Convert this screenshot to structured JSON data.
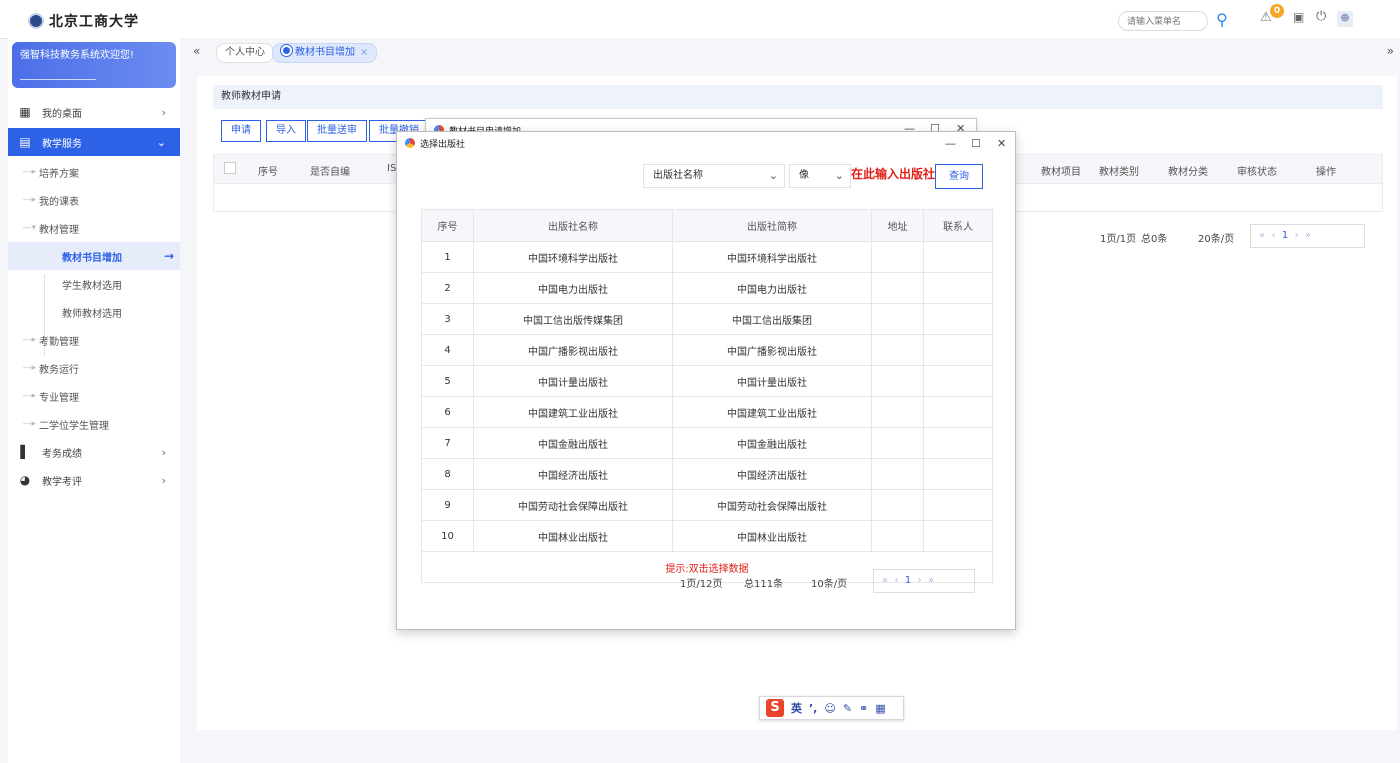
{
  "header": {
    "school_name": "北京工商大学",
    "search_placeholder": "请输入菜单名",
    "notification_count": "0"
  },
  "sidebar": {
    "welcome": "强智科技教务系统欢迎您!",
    "items": [
      {
        "label": "我的桌面"
      },
      {
        "label": "教学服务"
      },
      {
        "label": "培养方案"
      },
      {
        "label": "我的课表"
      },
      {
        "label": "教材管理"
      },
      {
        "label": "教材书目增加"
      },
      {
        "label": "学生教材选用"
      },
      {
        "label": "教师教材选用"
      },
      {
        "label": "考勤管理"
      },
      {
        "label": "教务运行"
      },
      {
        "label": "专业管理"
      },
      {
        "label": "二学位学生管理"
      },
      {
        "label": "考务成绩"
      },
      {
        "label": "教学考评"
      }
    ]
  },
  "tabs": {
    "home": "个人中心",
    "current": "教材书目增加"
  },
  "main": {
    "section_title": "教师教材申请",
    "buttons": [
      "申请",
      "导入",
      "批量送审",
      "批量撤销"
    ],
    "columns": [
      "序号",
      "是否自编",
      "IS",
      "教材项目",
      "教材类别",
      "教材分类",
      "审核状态",
      "操作"
    ],
    "pager": {
      "pages": "1页/1页",
      "total": "总0条",
      "size": "20条/页",
      "current": "1"
    }
  },
  "dialog_back": {
    "title": "教材书目申请增加"
  },
  "dialog": {
    "title": "选择出版社",
    "filter_field": "出版社名称",
    "filter_op": "像",
    "hint": "在此输入出版社",
    "query_label": "查询",
    "columns": [
      "序号",
      "出版社名称",
      "出版社简称",
      "地址",
      "联系人"
    ],
    "rows": [
      {
        "no": "1",
        "name": "中国环境科学出版社",
        "short": "中国环境科学出版社"
      },
      {
        "no": "2",
        "name": "中国电力出版社",
        "short": "中国电力出版社"
      },
      {
        "no": "3",
        "name": "中国工信出版传媒集团",
        "short": "中国工信出版集团"
      },
      {
        "no": "4",
        "name": "中国广播影视出版社",
        "short": "中国广播影视出版社"
      },
      {
        "no": "5",
        "name": "中国计量出版社",
        "short": "中国计量出版社"
      },
      {
        "no": "6",
        "name": "中国建筑工业出版社",
        "short": "中国建筑工业出版社"
      },
      {
        "no": "7",
        "name": "中国金融出版社",
        "short": "中国金融出版社"
      },
      {
        "no": "8",
        "name": "中国经济出版社",
        "short": "中国经济出版社"
      },
      {
        "no": "9",
        "name": "中国劳动社会保障出版社",
        "short": "中国劳动社会保障出版社"
      },
      {
        "no": "10",
        "name": "中国林业出版社",
        "short": "中国林业出版社"
      }
    ],
    "tip": "提示:双击选择数据",
    "pager": {
      "pages": "1页/12页",
      "total": "总111条",
      "size": "10条/页",
      "current": "1"
    }
  },
  "ime": {
    "logo": "S",
    "lang": "英"
  }
}
